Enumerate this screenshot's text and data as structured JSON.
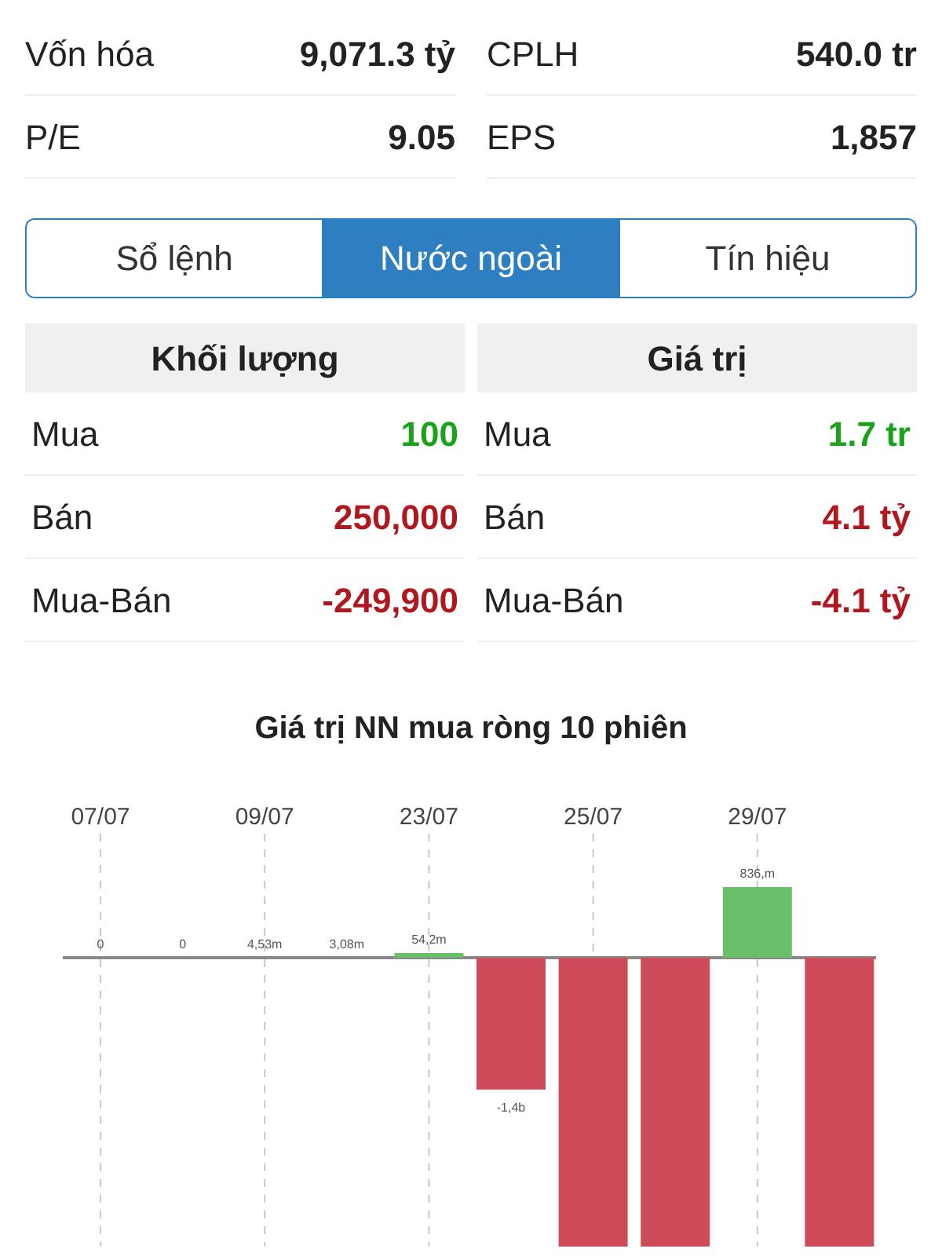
{
  "stats": [
    {
      "label": "Vốn hóa",
      "value": "9,071.3 tỷ"
    },
    {
      "label": "CPLH",
      "value": "540.0 tr"
    },
    {
      "label": "P/E",
      "value": "9.05"
    },
    {
      "label": "EPS",
      "value": "1,857"
    }
  ],
  "tabs": [
    {
      "label": "Sổ lệnh",
      "selected": false
    },
    {
      "label": "Nước ngoài",
      "selected": true
    },
    {
      "label": "Tín hiệu",
      "selected": false
    }
  ],
  "foreign_tables": [
    {
      "heading": "Khối lượng",
      "rows": [
        {
          "label": "Mua",
          "value": "100",
          "kind": "up"
        },
        {
          "label": "Bán",
          "value": "250,000",
          "kind": "down"
        },
        {
          "label": "Mua-Bán",
          "value": "-249,900",
          "kind": "down"
        }
      ]
    },
    {
      "heading": "Giá trị",
      "rows": [
        {
          "label": "Mua",
          "value": "1.7 tr",
          "kind": "up"
        },
        {
          "label": "Bán",
          "value": "4.1 tỷ",
          "kind": "down"
        },
        {
          "label": "Mua-Bán",
          "value": "-4.1 tỷ",
          "kind": "down"
        }
      ]
    }
  ],
  "chart": {
    "title": "Giá trị NN mua ròng 10 phiên",
    "dates": [
      "07/07",
      "09/07",
      "23/07",
      "25/07",
      "29/07"
    ],
    "bars": [
      {
        "label": "0",
        "kind": "flat"
      },
      {
        "label": "0",
        "kind": "flat"
      },
      {
        "label": "4,53m",
        "kind": "flat"
      },
      {
        "label": "3,08m",
        "kind": "flat"
      },
      {
        "label": "54,2m",
        "kind": "up"
      },
      {
        "label": "-1,4b",
        "kind": "down"
      },
      {
        "kind": "down"
      },
      {
        "kind": "down"
      },
      {
        "label": "836,m",
        "kind": "up"
      },
      {
        "kind": "down"
      }
    ]
  }
}
